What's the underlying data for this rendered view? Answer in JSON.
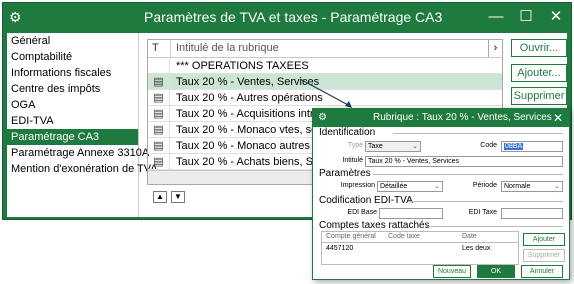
{
  "window": {
    "title": "Paramètres de TVA et taxes - Paramétrage CA3",
    "minimize": "—",
    "maximize": "☐",
    "close": "✕"
  },
  "sidebar": {
    "items": [
      {
        "label": "Général"
      },
      {
        "label": "Comptabilité"
      },
      {
        "label": "Informations fiscales"
      },
      {
        "label": "Centre des impôts"
      },
      {
        "label": "OGA"
      },
      {
        "label": "EDI-TVA"
      },
      {
        "label": "Paramétrage CA3"
      },
      {
        "label": "Paramétrage Annexe 3310A"
      },
      {
        "label": "Mention d'exonération de TVA"
      }
    ],
    "active_index": 6
  },
  "grid": {
    "col_type": "T",
    "col_label": "Intitulé de la rubrique",
    "scroll_arrow": "›",
    "rows": [
      {
        "label": "*** OPERATIONS TAXEES",
        "icon": false
      },
      {
        "label": "Taux 20 % - Ventes, Services",
        "icon": true
      },
      {
        "label": "Taux 20 % - Autres opérations",
        "icon": true
      },
      {
        "label": "Taux 20 % - Acquisitions intraco",
        "icon": true
      },
      {
        "label": "Taux 20 % - Monaco vtes, services",
        "icon": true
      },
      {
        "label": "Taux 20 % - Monaco autres op.",
        "icon": true
      },
      {
        "label": "Taux 20 % - Achats biens, Services",
        "icon": true
      }
    ],
    "selected_index": 1,
    "nav_up": "▲",
    "nav_down": "▼"
  },
  "buttons": {
    "open": "Ouvrir...",
    "add": "Ajouter...",
    "delete": "Supprimer"
  },
  "dialog": {
    "title": "Rubrique : Taux 20 % - Ventes, Services",
    "identification": "Identification",
    "type_label": "Type",
    "type_value": "Taxe",
    "code_label": "Code",
    "code_value": "08BA",
    "intitule_label": "Intitulé",
    "intitule_value": "Taux 20 % - Ventes, Services",
    "parametres": "Paramètres",
    "impression_label": "Impression",
    "impression_value": "Détaillée",
    "periode_label": "Période",
    "periode_value": "Normale",
    "codification": "Codification EDI-TVA",
    "edi_base_label": "EDI Base",
    "edi_taxe_label": "EDI Taxe",
    "comptes": "Comptes taxes rattachés",
    "col_compte": "Compte général",
    "col_code_taxe": "Code taxe",
    "col_date": "Date",
    "row_compte": "4457120",
    "row_date": "Les deux",
    "btn_ajouter": "Ajouter",
    "btn_supprimer": "Supprimer",
    "btn_nouveau": "Nouveau",
    "btn_ok": "OK",
    "btn_annuler": "Annuler"
  }
}
